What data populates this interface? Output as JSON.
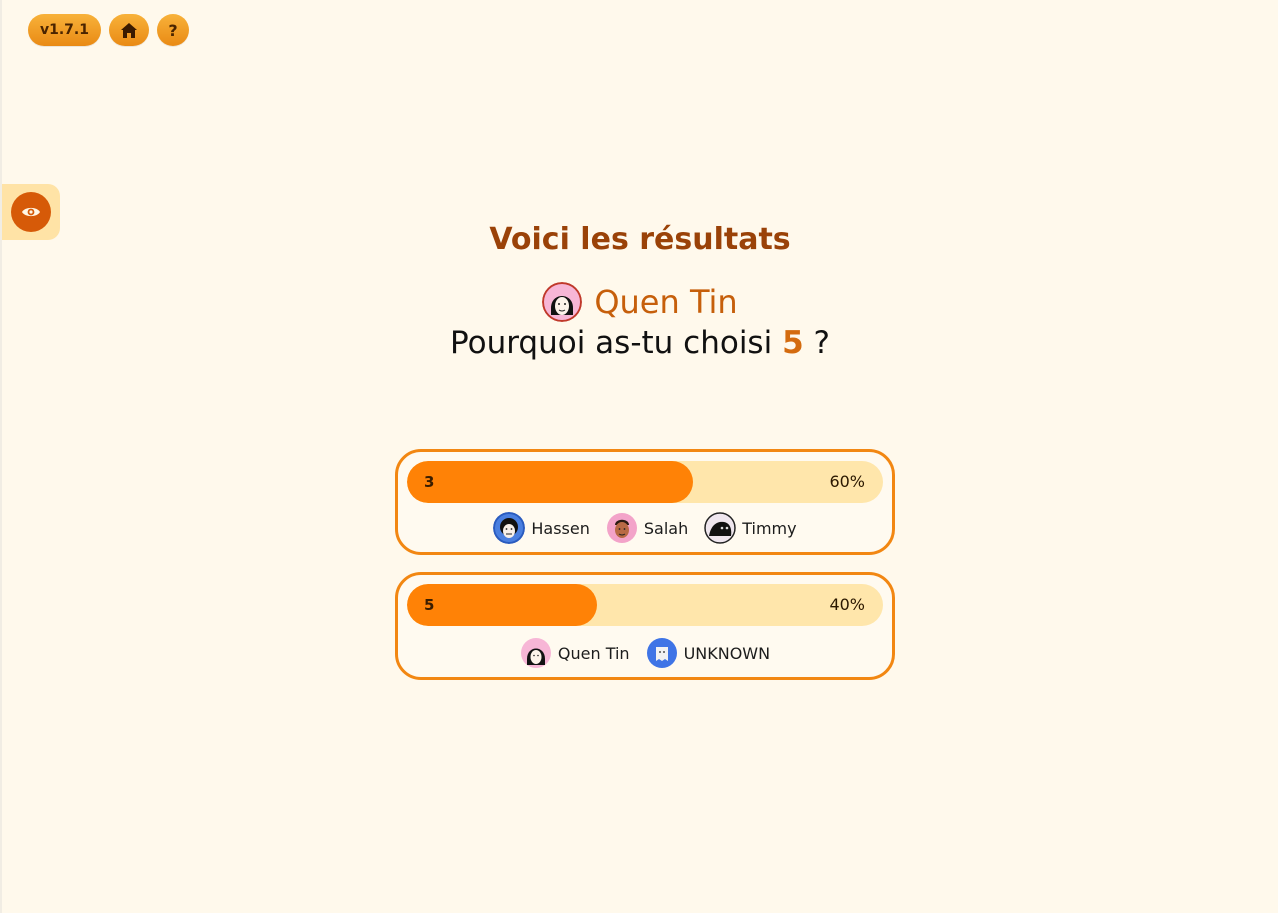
{
  "header": {
    "version": "v1.7.1",
    "help_label": "?"
  },
  "results": {
    "title": "Voici les résultats",
    "player": "Quen Tin",
    "question_prefix": "Pourquoi as-tu choisi",
    "question_value": "5",
    "question_suffix": "?"
  },
  "options": [
    {
      "label": "3",
      "percent_text": "60%",
      "percent": 60,
      "voters": [
        "Hassen",
        "Salah",
        "Timmy"
      ]
    },
    {
      "label": "5",
      "percent_text": "40%",
      "percent": 40,
      "voters": [
        "Quen Tin",
        "UNKNOWN"
      ]
    }
  ],
  "colors": {
    "accent": "#ff8206",
    "track": "#ffe6ab",
    "title": "#9a4208",
    "background": "#fff9ec"
  },
  "icons": {
    "home": "home-icon",
    "eye": "eye-icon",
    "help": "help-icon"
  }
}
